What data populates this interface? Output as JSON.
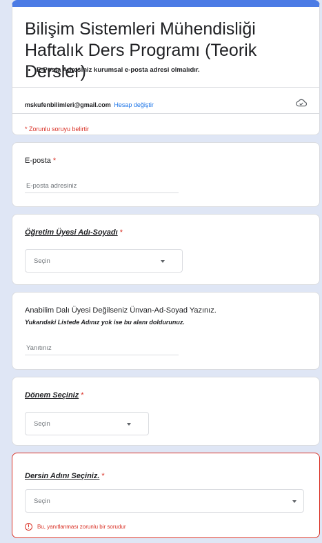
{
  "header": {
    "title": "Bilişim Sistemleri Mühendisliği Haftalık Ders Programı (Teorik Dersler)",
    "bullets": [
      "E-Posta Adresiniz kurumsal e-posta adresi olmalıdır."
    ],
    "account_email": "mskufenbilimleri@gmail.com",
    "switch_account": "Hesap değiştir",
    "cloud_icon": "cloud-check-icon",
    "required_note": "* Zorunlu soruyu belirtir"
  },
  "questions": {
    "email": {
      "title": "E-posta",
      "required_mark": "*",
      "placeholder": "E-posta adresiniz"
    },
    "lecturer": {
      "title": "Öğretim Üyesi Adı-Soyadı",
      "required_mark": "*",
      "dropdown": "Seçin"
    },
    "other_name": {
      "title": "Anabilim Dalı Üyesi Değilseniz Ünvan-Ad-Soyad Yazınız.",
      "help": "Yukarıdaki Listede Adınız yok ise bu alanı doldurunuz.",
      "placeholder": "Yanıtınız"
    },
    "term": {
      "title": "Dönem Seçiniz",
      "required_mark": "*",
      "dropdown": "Seçin"
    },
    "course": {
      "title": "Dersin Adını Seçiniz.",
      "required_mark": "*",
      "dropdown": "Seçin",
      "error": "Bu, yanıtlanması zorunlu bir sorudur"
    }
  },
  "colors": {
    "accent": "#4b7be5",
    "error": "#d93025",
    "link": "#1a73e8",
    "background": "#dfe6f5"
  }
}
